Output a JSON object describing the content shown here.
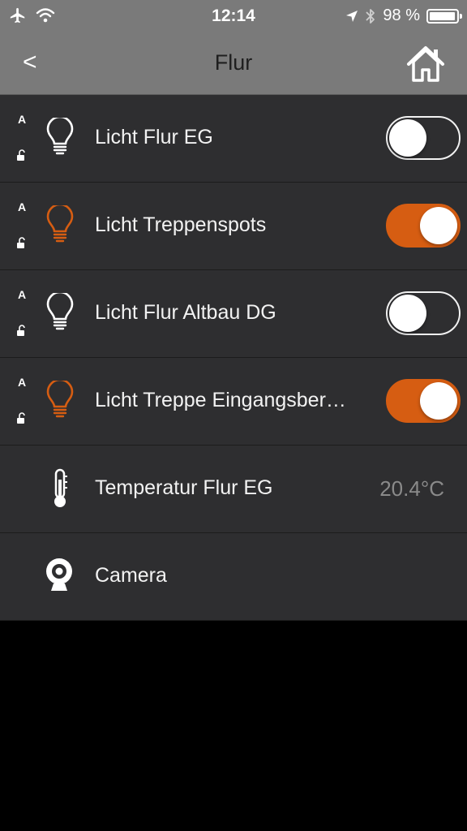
{
  "status_bar": {
    "time": "12:14",
    "battery": "98 %",
    "battery_level": 0.98,
    "icons": [
      "airplane-icon",
      "wifi-icon",
      "location-arrow-icon",
      "bluetooth-icon",
      "battery-icon"
    ]
  },
  "nav": {
    "back_label": "<",
    "title": "Flur",
    "home_icon": "home-icon"
  },
  "colors": {
    "accent": "#d65d12",
    "bar": "#7a7a7a",
    "row_bg": "#2e2e30",
    "value_text": "#8a8a8a"
  },
  "rows": [
    {
      "auto": "A",
      "label": "Licht Flur EG",
      "icon": "lightbulb-icon",
      "state": "off"
    },
    {
      "auto": "A",
      "label": "Licht Treppenspots",
      "icon": "lightbulb-icon",
      "state": "on"
    },
    {
      "auto": "A",
      "label": "Licht Flur Altbau DG",
      "icon": "lightbulb-icon",
      "state": "off"
    },
    {
      "auto": "A",
      "label": "Licht Treppe Eingangsber…",
      "icon": "lightbulb-icon",
      "state": "on"
    },
    {
      "label": "Temperatur Flur EG",
      "icon": "thermometer-icon",
      "value": "20.4°C"
    },
    {
      "label": "Camera",
      "icon": "camera-icon"
    }
  ]
}
